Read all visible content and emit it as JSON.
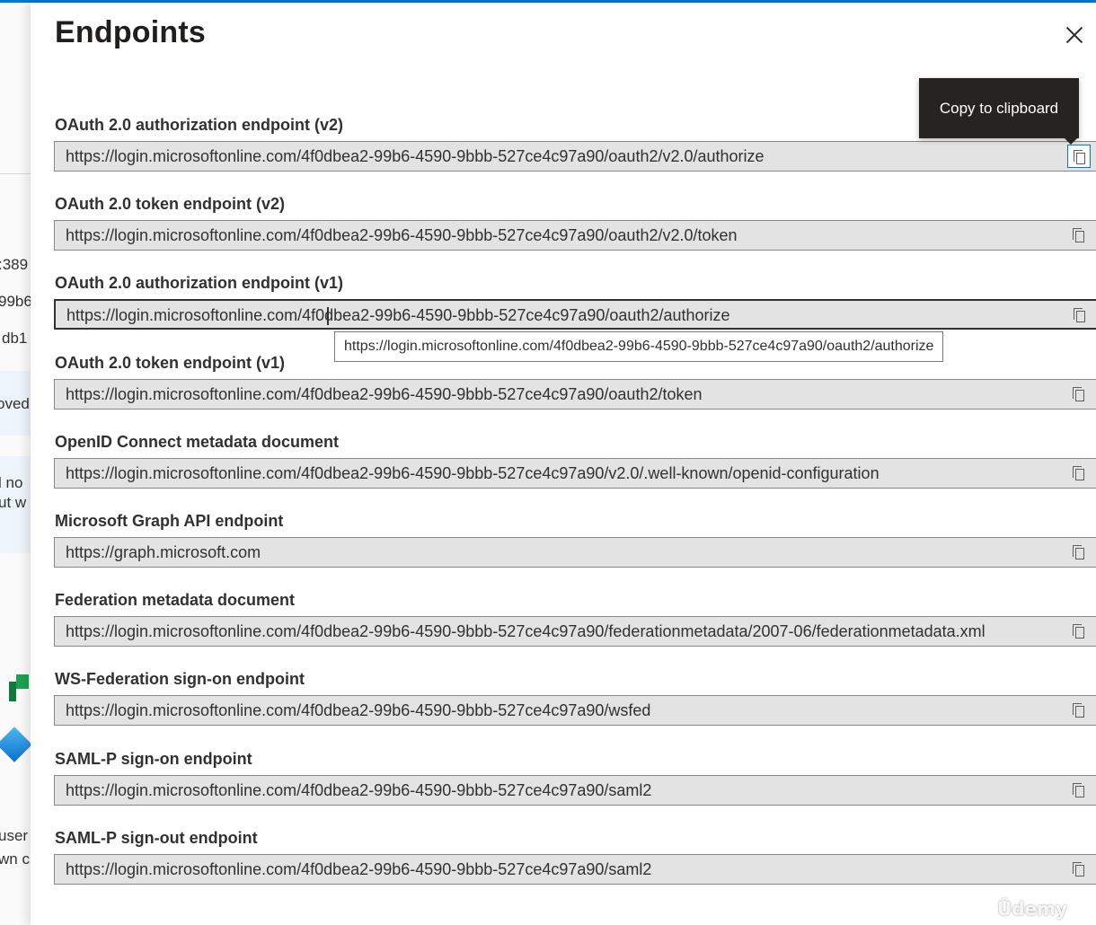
{
  "colors": {
    "accent": "#0078d4",
    "tooltip_bg": "#252423",
    "field_bg": "#e3e3e3"
  },
  "background": {
    "texts": [
      ":389",
      "99b6",
      "db1",
      "oved",
      "l no",
      "ut w",
      "user",
      "wn c"
    ]
  },
  "panel": {
    "title": "Endpoints",
    "close_icon": "close-icon",
    "tooltip": "Copy to clipboard",
    "hover_tooltip": "https://login.microsoftonline.com/4f0dbea2-99b6-4590-9bbb-527ce4c97a90/oauth2/authorize",
    "fields": [
      {
        "label": "OAuth 2.0 authorization endpoint (v2)",
        "value": "https://login.microsoftonline.com/4f0dbea2-99b6-4590-9bbb-527ce4c97a90/oauth2/v2.0/authorize"
      },
      {
        "label": "OAuth 2.0 token endpoint (v2)",
        "value": "https://login.microsoftonline.com/4f0dbea2-99b6-4590-9bbb-527ce4c97a90/oauth2/v2.0/token"
      },
      {
        "label": "OAuth 2.0 authorization endpoint (v1)",
        "value": "https://login.microsoftonline.com/4f0dbea2-99b6-4590-9bbb-527ce4c97a90/oauth2/authorize"
      },
      {
        "label": "OAuth 2.0 token endpoint (v1)",
        "value": "https://login.microsoftonline.com/4f0dbea2-99b6-4590-9bbb-527ce4c97a90/oauth2/token"
      },
      {
        "label": "OpenID Connect metadata document",
        "value": "https://login.microsoftonline.com/4f0dbea2-99b6-4590-9bbb-527ce4c97a90/v2.0/.well-known/openid-configuration"
      },
      {
        "label": "Microsoft Graph API endpoint",
        "value": "https://graph.microsoft.com"
      },
      {
        "label": "Federation metadata document",
        "value": "https://login.microsoftonline.com/4f0dbea2-99b6-4590-9bbb-527ce4c97a90/federationmetadata/2007-06/federationmetadata.xml"
      },
      {
        "label": "WS-Federation sign-on endpoint",
        "value": "https://login.microsoftonline.com/4f0dbea2-99b6-4590-9bbb-527ce4c97a90/wsfed"
      },
      {
        "label": "SAML-P sign-on endpoint",
        "value": "https://login.microsoftonline.com/4f0dbea2-99b6-4590-9bbb-527ce4c97a90/saml2"
      },
      {
        "label": "SAML-P sign-out endpoint",
        "value": "https://login.microsoftonline.com/4f0dbea2-99b6-4590-9bbb-527ce4c97a90/saml2"
      }
    ]
  },
  "watermark": "Ûdemy"
}
